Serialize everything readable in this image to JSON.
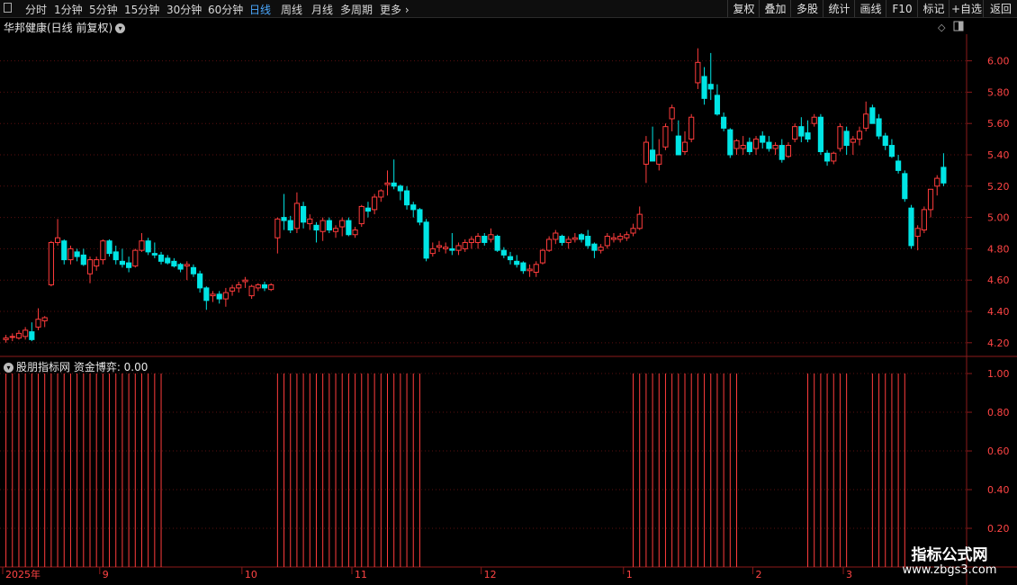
{
  "toolbar": {
    "periods": [
      {
        "label": "分时",
        "active": false
      },
      {
        "label": "1分钟",
        "active": false
      },
      {
        "label": "5分钟",
        "active": false
      },
      {
        "label": "15分钟",
        "active": false
      },
      {
        "label": "30分钟",
        "active": false
      },
      {
        "label": "60分钟",
        "active": false
      },
      {
        "label": "日线",
        "active": true
      },
      {
        "label": "周线",
        "active": false
      },
      {
        "label": "月线",
        "active": false
      },
      {
        "label": "多周期",
        "active": false
      },
      {
        "label": "更多",
        "active": false
      }
    ],
    "right_buttons": [
      "复权",
      "叠加",
      "多股",
      "统计",
      "画线",
      "F10",
      "标记",
      "+自选",
      "返回"
    ]
  },
  "chart_title": "华邦健康(日线 前复权)",
  "indicator_title": "股朋指标网 资金博弈: 0.00",
  "watermark": {
    "title": "指标公式网",
    "url": "www.zbgs3.com"
  },
  "x_axis_labels": [
    {
      "text": "2025年",
      "index": 0
    },
    {
      "text": "9",
      "index": 15
    },
    {
      "text": "10",
      "index": 37
    },
    {
      "text": "11",
      "index": 54
    },
    {
      "text": "12",
      "index": 74
    },
    {
      "text": "1",
      "index": 96
    },
    {
      "text": "2",
      "index": 116
    },
    {
      "text": "3",
      "index": 130
    }
  ],
  "colors": {
    "up": "#ff3c3c",
    "down": "#00e5e5",
    "axis": "#8b1a1a",
    "label": "#ff4444"
  },
  "chart_data": [
    {
      "type": "candlestick",
      "title": "华邦健康(日线 前复权)",
      "ylim": [
        4.13,
        6.17
      ],
      "y_ticks": [
        4.2,
        4.4,
        4.6,
        4.8,
        5.0,
        5.2,
        5.4,
        5.6,
        5.8,
        6.0
      ],
      "candles": [
        [
          4.22,
          4.25,
          4.2,
          4.23
        ],
        [
          4.24,
          4.26,
          4.21,
          4.24
        ],
        [
          4.23,
          4.28,
          4.22,
          4.26
        ],
        [
          4.24,
          4.3,
          4.22,
          4.28
        ],
        [
          4.27,
          4.33,
          4.21,
          4.22
        ],
        [
          4.3,
          4.42,
          4.28,
          4.35
        ],
        [
          4.34,
          4.37,
          4.3,
          4.36
        ],
        [
          4.57,
          4.85,
          4.56,
          4.84
        ],
        [
          4.84,
          4.99,
          4.82,
          4.87
        ],
        [
          4.85,
          4.86,
          4.7,
          4.73
        ],
        [
          4.73,
          4.82,
          4.7,
          4.8
        ],
        [
          4.78,
          4.8,
          4.72,
          4.75
        ],
        [
          4.76,
          4.8,
          4.69,
          4.7
        ],
        [
          4.64,
          4.75,
          4.58,
          4.73
        ],
        [
          4.69,
          4.75,
          4.66,
          4.73
        ],
        [
          4.73,
          4.86,
          4.7,
          4.85
        ],
        [
          4.85,
          4.86,
          4.75,
          4.77
        ],
        [
          4.78,
          4.82,
          4.7,
          4.73
        ],
        [
          4.72,
          4.8,
          4.68,
          4.7
        ],
        [
          4.71,
          4.75,
          4.65,
          4.68
        ],
        [
          4.69,
          4.8,
          4.68,
          4.79
        ],
        [
          4.79,
          4.9,
          4.78,
          4.85
        ],
        [
          4.85,
          4.87,
          4.76,
          4.78
        ],
        [
          4.77,
          4.84,
          4.74,
          4.76
        ],
        [
          4.76,
          4.78,
          4.7,
          4.72
        ],
        [
          4.74,
          4.76,
          4.7,
          4.71
        ],
        [
          4.72,
          4.74,
          4.68,
          4.69
        ],
        [
          4.7,
          4.71,
          4.65,
          4.67
        ],
        [
          4.69,
          4.72,
          4.6,
          4.7
        ],
        [
          4.68,
          4.7,
          4.62,
          4.64
        ],
        [
          4.64,
          4.66,
          4.52,
          4.55
        ],
        [
          4.55,
          4.56,
          4.41,
          4.47
        ],
        [
          4.5,
          4.53,
          4.46,
          4.51
        ],
        [
          4.51,
          4.53,
          4.45,
          4.48
        ],
        [
          4.48,
          4.55,
          4.43,
          4.52
        ],
        [
          4.53,
          4.57,
          4.5,
          4.55
        ],
        [
          4.55,
          4.59,
          4.52,
          4.57
        ],
        [
          4.59,
          4.62,
          4.55,
          4.6
        ],
        [
          4.5,
          4.57,
          4.48,
          4.56
        ],
        [
          4.55,
          4.58,
          4.53,
          4.57
        ],
        [
          4.57,
          4.59,
          4.53,
          4.55
        ],
        [
          4.54,
          4.58,
          4.53,
          4.57
        ],
        [
          4.87,
          5.0,
          4.77,
          4.99
        ],
        [
          5.0,
          5.15,
          4.92,
          4.98
        ],
        [
          4.98,
          5.01,
          4.9,
          4.92
        ],
        [
          4.93,
          5.16,
          4.9,
          5.09
        ],
        [
          5.07,
          5.1,
          4.93,
          4.97
        ],
        [
          4.96,
          5.02,
          4.92,
          4.99
        ],
        [
          4.95,
          4.97,
          4.84,
          4.92
        ],
        [
          4.91,
          5.0,
          4.85,
          4.98
        ],
        [
          4.98,
          5.0,
          4.9,
          4.92
        ],
        [
          4.91,
          4.95,
          4.87,
          4.93
        ],
        [
          4.94,
          5.0,
          4.88,
          4.98
        ],
        [
          4.98,
          5.0,
          4.88,
          4.89
        ],
        [
          4.89,
          4.94,
          4.87,
          4.92
        ],
        [
          4.96,
          5.08,
          4.94,
          5.07
        ],
        [
          5.06,
          5.1,
          5.0,
          5.04
        ],
        [
          5.05,
          5.15,
          5.02,
          5.13
        ],
        [
          5.13,
          5.18,
          5.1,
          5.17
        ],
        [
          5.21,
          5.3,
          5.14,
          5.22
        ],
        [
          5.22,
          5.37,
          5.18,
          5.2
        ],
        [
          5.2,
          5.21,
          5.11,
          5.17
        ],
        [
          5.17,
          5.2,
          5.05,
          5.08
        ],
        [
          5.08,
          5.1,
          5.0,
          5.05
        ],
        [
          5.05,
          5.06,
          4.95,
          4.97
        ],
        [
          4.97,
          4.99,
          4.72,
          4.74
        ],
        [
          4.77,
          4.84,
          4.75,
          4.8
        ],
        [
          4.81,
          4.85,
          4.78,
          4.82
        ],
        [
          4.8,
          4.84,
          4.77,
          4.81
        ],
        [
          4.8,
          4.9,
          4.76,
          4.79
        ],
        [
          4.79,
          4.84,
          4.76,
          4.82
        ],
        [
          4.8,
          4.86,
          4.78,
          4.84
        ],
        [
          4.84,
          4.88,
          4.8,
          4.86
        ],
        [
          4.84,
          4.9,
          4.8,
          4.88
        ],
        [
          4.88,
          4.9,
          4.82,
          4.84
        ],
        [
          4.86,
          4.93,
          4.84,
          4.89
        ],
        [
          4.88,
          4.89,
          4.78,
          4.79
        ],
        [
          4.79,
          4.81,
          4.74,
          4.76
        ],
        [
          4.75,
          4.78,
          4.7,
          4.73
        ],
        [
          4.72,
          4.76,
          4.68,
          4.7
        ],
        [
          4.71,
          4.72,
          4.64,
          4.66
        ],
        [
          4.66,
          4.7,
          4.62,
          4.67
        ],
        [
          4.65,
          4.72,
          4.62,
          4.7
        ],
        [
          4.71,
          4.8,
          4.7,
          4.79
        ],
        [
          4.79,
          4.88,
          4.78,
          4.86
        ],
        [
          4.86,
          4.92,
          4.83,
          4.9
        ],
        [
          4.88,
          4.89,
          4.82,
          4.84
        ],
        [
          4.84,
          4.88,
          4.8,
          4.86
        ],
        [
          4.86,
          4.9,
          4.84,
          4.87
        ],
        [
          4.89,
          4.9,
          4.84,
          4.86
        ],
        [
          4.88,
          4.92,
          4.8,
          4.82
        ],
        [
          4.83,
          4.84,
          4.74,
          4.79
        ],
        [
          4.79,
          4.83,
          4.77,
          4.81
        ],
        [
          4.82,
          4.9,
          4.8,
          4.88
        ],
        [
          4.86,
          4.9,
          4.84,
          4.87
        ],
        [
          4.86,
          4.9,
          4.84,
          4.88
        ],
        [
          4.87,
          4.91,
          4.85,
          4.89
        ],
        [
          4.9,
          4.96,
          4.88,
          4.93
        ],
        [
          4.93,
          5.07,
          4.92,
          5.02
        ],
        [
          5.34,
          5.52,
          5.22,
          5.48
        ],
        [
          5.43,
          5.58,
          5.36,
          5.36
        ],
        [
          5.34,
          5.5,
          5.3,
          5.4
        ],
        [
          5.45,
          5.6,
          5.43,
          5.58
        ],
        [
          5.63,
          5.72,
          5.55,
          5.7
        ],
        [
          5.52,
          5.62,
          5.4,
          5.4
        ],
        [
          5.42,
          5.55,
          5.4,
          5.48
        ],
        [
          5.5,
          5.66,
          5.48,
          5.64
        ],
        [
          5.86,
          6.08,
          5.82,
          5.99
        ],
        [
          5.9,
          5.96,
          5.72,
          5.76
        ],
        [
          5.85,
          6.05,
          5.75,
          5.82
        ],
        [
          5.78,
          5.85,
          5.65,
          5.66
        ],
        [
          5.64,
          5.67,
          5.55,
          5.57
        ],
        [
          5.56,
          5.57,
          5.38,
          5.4
        ],
        [
          5.44,
          5.5,
          5.4,
          5.49
        ],
        [
          5.44,
          5.52,
          5.4,
          5.46
        ],
        [
          5.48,
          5.51,
          5.4,
          5.42
        ],
        [
          5.44,
          5.52,
          5.4,
          5.5
        ],
        [
          5.52,
          5.55,
          5.44,
          5.48
        ],
        [
          5.48,
          5.52,
          5.42,
          5.44
        ],
        [
          5.44,
          5.48,
          5.4,
          5.46
        ],
        [
          5.46,
          5.5,
          5.35,
          5.37
        ],
        [
          5.39,
          5.48,
          5.38,
          5.46
        ],
        [
          5.5,
          5.6,
          5.48,
          5.58
        ],
        [
          5.58,
          5.64,
          5.48,
          5.52
        ],
        [
          5.54,
          5.62,
          5.48,
          5.5
        ],
        [
          5.6,
          5.66,
          5.58,
          5.64
        ],
        [
          5.64,
          5.66,
          5.4,
          5.42
        ],
        [
          5.41,
          5.43,
          5.33,
          5.36
        ],
        [
          5.36,
          5.42,
          5.34,
          5.41
        ],
        [
          5.44,
          5.6,
          5.42,
          5.58
        ],
        [
          5.55,
          5.58,
          5.4,
          5.46
        ],
        [
          5.48,
          5.52,
          5.4,
          5.5
        ],
        [
          5.5,
          5.58,
          5.46,
          5.55
        ],
        [
          5.57,
          5.74,
          5.55,
          5.66
        ],
        [
          5.7,
          5.72,
          5.6,
          5.6
        ],
        [
          5.63,
          5.66,
          5.5,
          5.52
        ],
        [
          5.52,
          5.54,
          5.43,
          5.46
        ],
        [
          5.46,
          5.5,
          5.38,
          5.39
        ],
        [
          5.36,
          5.4,
          5.28,
          5.3
        ],
        [
          5.28,
          5.3,
          5.1,
          5.12
        ],
        [
          5.06,
          5.08,
          4.8,
          4.82
        ],
        [
          4.88,
          4.95,
          4.79,
          4.93
        ],
        [
          4.92,
          5.07,
          4.9,
          5.05
        ],
        [
          5.05,
          5.16,
          5.0,
          5.18
        ],
        [
          5.2,
          5.27,
          5.14,
          5.25
        ],
        [
          5.32,
          5.41,
          5.2,
          5.22
        ]
      ]
    },
    {
      "type": "bar",
      "title": "股朋指标网 资金博弈: 0.00",
      "ylim": [
        0,
        1.07
      ],
      "y_ticks": [
        0.2,
        0.4,
        0.6,
        0.8,
        1.0
      ],
      "signal_value": 1.0,
      "signal_ranges": [
        [
          0,
          24
        ],
        [
          42,
          64
        ],
        [
          97,
          113
        ],
        [
          124,
          130
        ],
        [
          134,
          139
        ]
      ]
    }
  ]
}
